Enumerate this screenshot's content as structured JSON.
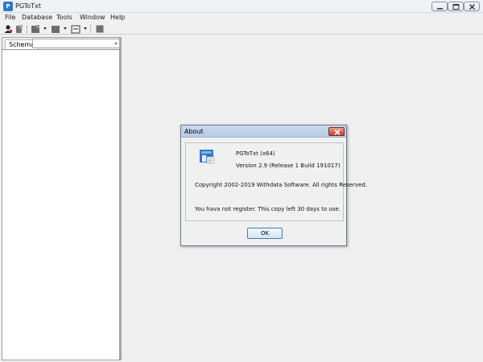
{
  "window": {
    "title": "PGToTxt"
  },
  "menu": {
    "items": [
      "File",
      "Database",
      "Tools",
      "Window",
      "Help"
    ]
  },
  "left_panel": {
    "tab_label": "Schema",
    "schema_value": ""
  },
  "dialog": {
    "title": "About",
    "product": "PGToTxt (x64)",
    "version": "Version 2.9 (Release 1 Build 191017)",
    "copyright": "Copyright 2002-2019 Withdata Software.  All rights Reserved.",
    "register_notice": "You hava not register. This copy left 30 days to use.",
    "ok_label": "OK"
  },
  "colors": {
    "accent": "#2f78c4",
    "close_red": "#c4402c",
    "workspace_bg": "#efefef"
  },
  "icons": [
    "app-icon",
    "minimize-icon",
    "maximize-icon",
    "close-icon",
    "connect-icon",
    "disconnect-icon",
    "table-icon",
    "view-icon",
    "export-icon",
    "stop-icon",
    "product-logo-icon"
  ]
}
